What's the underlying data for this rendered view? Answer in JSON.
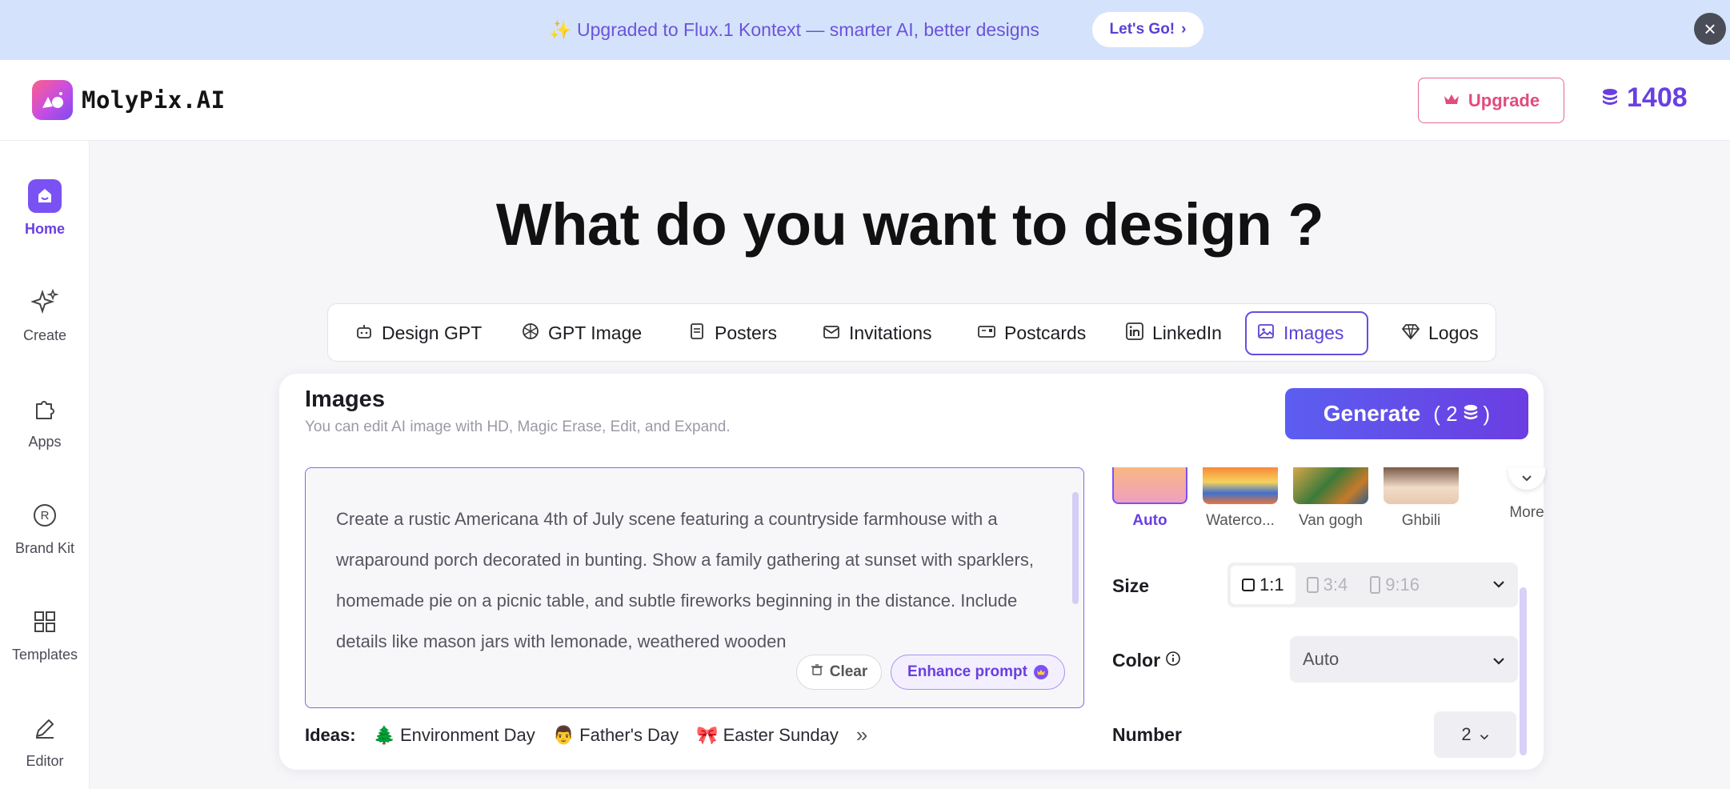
{
  "banner": {
    "text": "✨ Upgraded to Flux.1 Kontext — smarter AI, better designs",
    "cta": "Let's Go!",
    "accent": "#6b53d9",
    "background": "#d4e3fb"
  },
  "header": {
    "logo_text": "MolyPix.AI",
    "upgrade_label": "Upgrade",
    "credits": "1408",
    "brand_color": "#6a3fe0"
  },
  "sidebar": {
    "items": [
      {
        "label": "Home",
        "icon": "home-icon",
        "active": true
      },
      {
        "label": "Create",
        "icon": "sparkles-icon"
      },
      {
        "label": "Apps",
        "icon": "puzzle-icon"
      },
      {
        "label": "Brand Kit",
        "icon": "registered-icon"
      },
      {
        "label": "Templates",
        "icon": "grid-icon"
      },
      {
        "label": "Editor",
        "icon": "pencil-icon"
      }
    ]
  },
  "main": {
    "title": "What do you want to design ?",
    "tabs": [
      {
        "label": "Design GPT",
        "icon": "robot-icon"
      },
      {
        "label": "GPT Image",
        "icon": "openai-icon"
      },
      {
        "label": "Posters",
        "icon": "poster-icon"
      },
      {
        "label": "Invitations",
        "icon": "envelope-icon"
      },
      {
        "label": "Postcards",
        "icon": "postcard-icon"
      },
      {
        "label": "LinkedIn",
        "icon": "linkedin-icon"
      },
      {
        "label": "Images",
        "icon": "image-icon",
        "active": true
      },
      {
        "label": "Logos",
        "icon": "diamond-icon"
      }
    ]
  },
  "panel": {
    "title": "Images",
    "subtitle": "You can edit AI image with HD, Magic Erase, Edit, and Expand.",
    "generate_label": "Generate",
    "generate_cost": "( 2",
    "generate_cost_close": ")",
    "prompt": "Create a rustic Americana 4th of July scene featuring a countryside farmhouse with a wraparound porch decorated in bunting. Show a family gathering at sunset with sparklers, homemade pie on a picnic table, and subtle fireworks beginning in the distance. Include details like mason jars with lemonade, weathered wooden",
    "clear_label": "Clear",
    "enhance_label": "Enhance prompt",
    "ideas_label": "Ideas:",
    "ideas": [
      {
        "emoji": "🌲",
        "label": "Environment Day"
      },
      {
        "emoji": "👨",
        "label": "Father's Day"
      },
      {
        "emoji": "🎀",
        "label": "Easter Sunday"
      }
    ],
    "styles": [
      {
        "label": "Auto",
        "active": true
      },
      {
        "label": "Waterco..."
      },
      {
        "label": "Van gogh"
      },
      {
        "label": "Ghbili"
      }
    ],
    "more_label": "More",
    "size_label": "Size",
    "sizes": [
      "1:1",
      "3:4",
      "9:16"
    ],
    "selected_size": "1:1",
    "color_label": "Color",
    "color_value": "Auto",
    "number_label": "Number",
    "number_value": "2"
  }
}
